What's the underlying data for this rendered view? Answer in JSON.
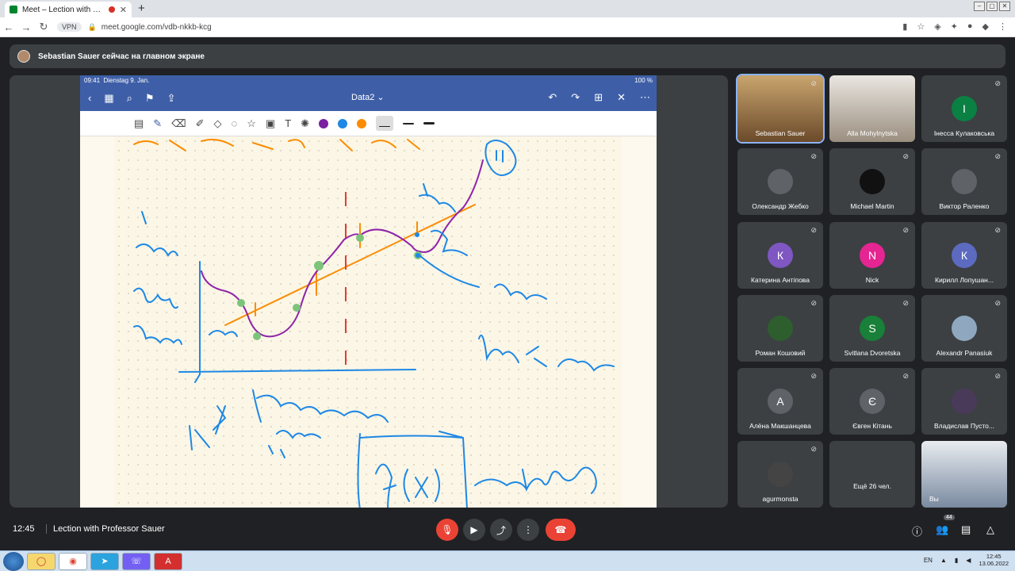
{
  "browser": {
    "tab_title": "Meet – Lection with Professor Sauer",
    "tab_close": "✕",
    "new_tab": "+",
    "vpn_label": "VPN",
    "url": "meet.google.com/vdb-nkkb-kcg"
  },
  "meet": {
    "presenting_text": "Sebastian Sauer сейчас на главном экране",
    "time": "12:45",
    "meeting_title": "Lection with Professor Sauer",
    "participants_count": "44",
    "more_label": "Ещё 26 чел.",
    "participants": [
      {
        "name": "Sebastian Sauer",
        "initial": "",
        "color": "",
        "video": true
      },
      {
        "name": "Alla Mohylnytska",
        "initial": "",
        "color": "",
        "video": true
      },
      {
        "name": "Інесса Кулаковська",
        "initial": "І",
        "color": "#0b8043"
      },
      {
        "name": "Олександр Жебко",
        "initial": "",
        "color": "#5f6368"
      },
      {
        "name": "Michael Martin",
        "initial": "",
        "color": "#111111"
      },
      {
        "name": "Виктор Раленко",
        "initial": "",
        "color": "#5f6368"
      },
      {
        "name": "Катерина Антіпова",
        "initial": "К",
        "color": "#7e57c2"
      },
      {
        "name": "Nick",
        "initial": "N",
        "color": "#e52592"
      },
      {
        "name": "Кирилл Лопушан...",
        "initial": "К",
        "color": "#5c6bc0"
      },
      {
        "name": "Роман Кошовий",
        "initial": "",
        "color": "#2e5e2e"
      },
      {
        "name": "Svitlana Dvoretska",
        "initial": "S",
        "color": "#188038"
      },
      {
        "name": "Alexandr Panasiuk",
        "initial": "",
        "color": "#8fa8c0"
      },
      {
        "name": "Алёна Макшанцева",
        "initial": "А",
        "color": "#5f6368"
      },
      {
        "name": "Євген Кітань",
        "initial": "Є",
        "color": "#5f6368"
      },
      {
        "name": "Владислав Пусто...",
        "initial": "",
        "color": "#4a3a5a"
      },
      {
        "name": "agurmonsta",
        "initial": "",
        "color": "#444444"
      },
      {
        "name": "",
        "initial": "",
        "color": ""
      },
      {
        "name": "Вы",
        "initial": "",
        "color": "",
        "video": true
      }
    ]
  },
  "ipad": {
    "status_time": "09:41",
    "status_date": "Dienstag 9. Jan.",
    "battery": "100 %",
    "doc_title": "Data2 ⌄",
    "colors": [
      "#7b1fa2",
      "#1e88e5",
      "#fb8c00"
    ]
  },
  "taskbar": {
    "lang": "EN",
    "clock_time": "12:45",
    "clock_date": "13.06.2022"
  }
}
